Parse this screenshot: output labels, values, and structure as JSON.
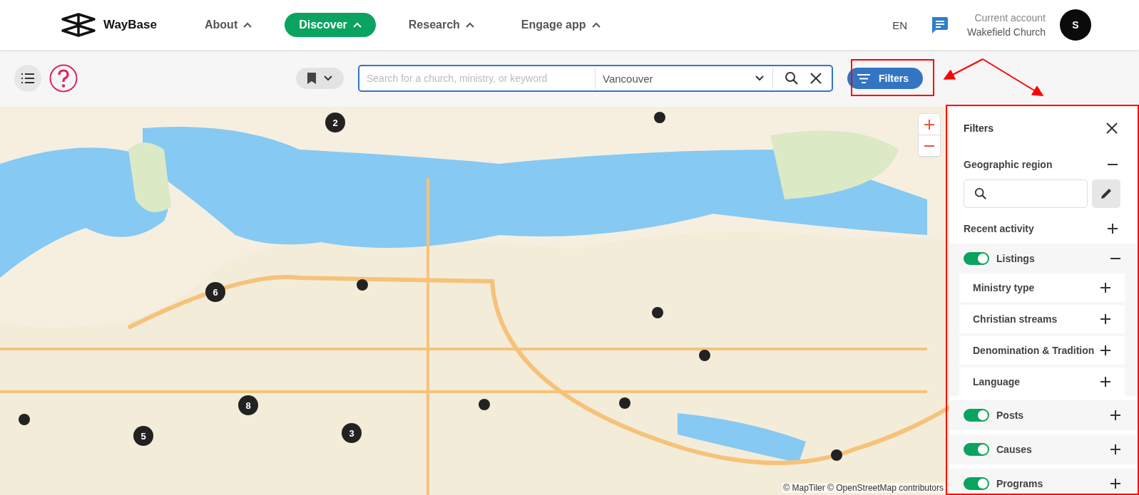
{
  "header": {
    "logo": "WayBase",
    "nav": [
      {
        "label": "About",
        "selected": false
      },
      {
        "label": "Discover",
        "selected": true
      },
      {
        "label": "Research",
        "selected": false
      },
      {
        "label": "Engage app",
        "selected": false
      }
    ],
    "language": "EN",
    "account": {
      "caption": "Current account",
      "name": "Wakefield Church",
      "avatar": "S"
    }
  },
  "toolbar": {
    "search": {
      "placeholder": "Search for a church, ministry, or keyword"
    },
    "location": {
      "value": "Vancouver"
    },
    "filters_button": "Filters"
  },
  "map": {
    "markers": [
      {
        "kind": "cluster",
        "label": "2"
      },
      {
        "kind": "point"
      },
      {
        "kind": "cluster",
        "label": "6"
      },
      {
        "kind": "point"
      },
      {
        "kind": "point"
      },
      {
        "kind": "point"
      },
      {
        "kind": "cluster",
        "label": "8"
      },
      {
        "kind": "point"
      },
      {
        "kind": "cluster",
        "label": "5"
      },
      {
        "kind": "cluster",
        "label": "3"
      },
      {
        "kind": "point"
      },
      {
        "kind": "point"
      },
      {
        "kind": "point"
      }
    ],
    "attribution": "© MapTiler © OpenStreetMap contributors"
  },
  "filters": {
    "title": "Filters",
    "sections": [
      {
        "kind": "search",
        "label": "Geographic region",
        "expanded": true
      },
      {
        "kind": "plain",
        "label": "Recent activity",
        "expanded": false
      },
      {
        "kind": "toggle",
        "label": "Listings",
        "on": true,
        "expanded": true,
        "children": [
          {
            "label": "Ministry type",
            "expanded": false
          },
          {
            "label": "Christian streams",
            "expanded": false
          },
          {
            "label": "Denomination & Tradition",
            "expanded": false
          },
          {
            "label": "Language",
            "expanded": false
          }
        ]
      },
      {
        "kind": "toggle",
        "label": "Posts",
        "on": true,
        "expanded": false
      },
      {
        "kind": "toggle",
        "label": "Causes",
        "on": true,
        "expanded": false
      },
      {
        "kind": "toggle",
        "label": "Programs",
        "on": true,
        "expanded": false
      }
    ]
  }
}
